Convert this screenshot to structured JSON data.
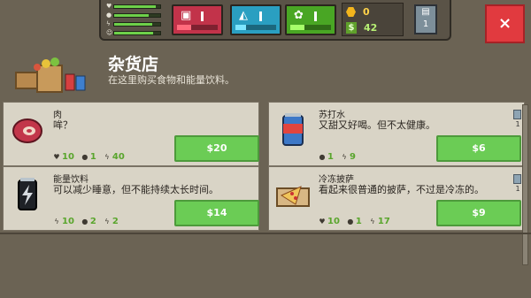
{
  "hud": {
    "stats": [
      {
        "icon": "heart-icon",
        "fill": 0.9
      },
      {
        "icon": "drop-icon",
        "fill": 0.75
      },
      {
        "icon": "bolt-icon",
        "fill": 0.82
      },
      {
        "icon": "smile-icon",
        "fill": 0.85
      }
    ],
    "needs": [
      {
        "name": "hunger",
        "icon": "food-bag-icon",
        "level": 0.35
      },
      {
        "name": "thirst",
        "icon": "water-icon",
        "level": 0.25
      },
      {
        "name": "energy",
        "icon": "energy-icon",
        "level": 0.35
      }
    ],
    "gold": "0",
    "cash": "42",
    "side_button": "1",
    "close_label": "×"
  },
  "store": {
    "title": "杂货店",
    "subtitle": "在这里购买食物和能量饮料。"
  },
  "items": [
    {
      "name": "肉",
      "desc": "哞？",
      "icon": "meat-icon",
      "effects": [
        {
          "icon": "heart",
          "value": "10"
        },
        {
          "icon": "drop",
          "value": "1"
        },
        {
          "icon": "bolt",
          "value": "40"
        }
      ],
      "price": "$20"
    },
    {
      "name": "苏打水",
      "desc": "又甜又好喝。但不太健康。",
      "icon": "soda-can-icon",
      "effects": [
        {
          "icon": "drop",
          "value": "1"
        },
        {
          "icon": "bolt",
          "value": "9"
        }
      ],
      "price": "$6",
      "owned": "1"
    },
    {
      "name": "能量饮料",
      "desc": "可以减少睡意，但不能持续太长时间。",
      "icon": "energy-drink-icon",
      "effects": [
        {
          "icon": "bolt",
          "value": "10"
        },
        {
          "icon": "drop",
          "value": "2"
        },
        {
          "icon": "bolt",
          "value": "2"
        }
      ],
      "price": "$14"
    },
    {
      "name": "冷冻披萨",
      "desc": "看起来很普通的披萨，不过是冷冻的。",
      "icon": "pizza-box-icon",
      "effects": [
        {
          "icon": "heart",
          "value": "10"
        },
        {
          "icon": "drop",
          "value": "1"
        },
        {
          "icon": "bolt",
          "value": "17"
        }
      ],
      "price": "$9",
      "owned": "1"
    }
  ],
  "colors": {
    "background": "#6b6354",
    "card": "#d9d4c6",
    "buy_button": "#6bcc55",
    "close_button": "#e13a3f"
  }
}
